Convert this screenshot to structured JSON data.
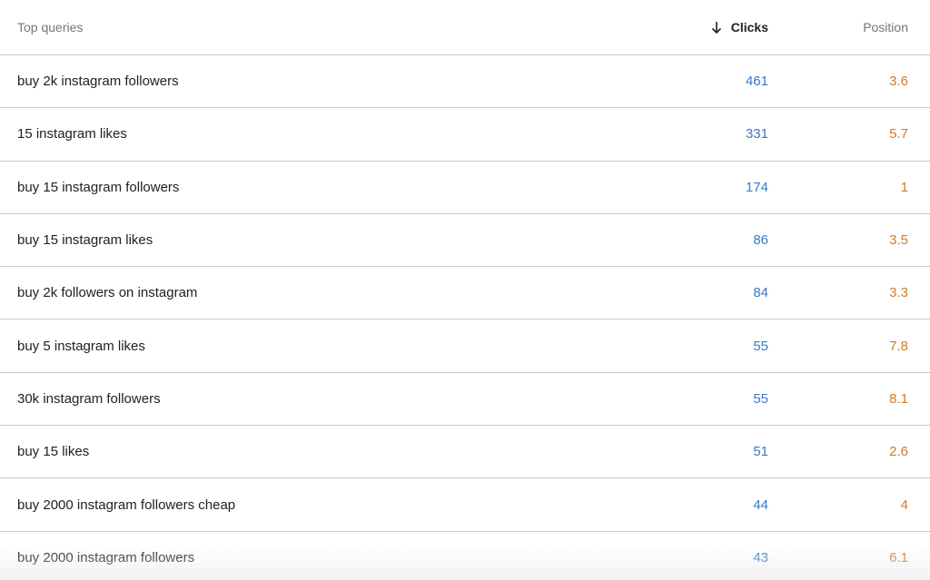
{
  "header": {
    "query_label": "Top queries",
    "clicks_label": "Clicks",
    "position_label": "Position",
    "sort_icon": "arrow-down-icon"
  },
  "colors": {
    "clicks": "#3a78c9",
    "position": "#d07b28"
  },
  "rows": [
    {
      "query": "buy 2k instagram followers",
      "clicks": "461",
      "position": "3.6"
    },
    {
      "query": "15 instagram likes",
      "clicks": "331",
      "position": "5.7"
    },
    {
      "query": "buy 15 instagram followers",
      "clicks": "174",
      "position": "1"
    },
    {
      "query": "buy 15 instagram likes",
      "clicks": "86",
      "position": "3.5"
    },
    {
      "query": "buy 2k followers on instagram",
      "clicks": "84",
      "position": "3.3"
    },
    {
      "query": "buy 5 instagram likes",
      "clicks": "55",
      "position": "7.8"
    },
    {
      "query": "30k instagram followers",
      "clicks": "55",
      "position": "8.1"
    },
    {
      "query": "buy 15 likes",
      "clicks": "51",
      "position": "2.6"
    },
    {
      "query": "buy 2000 instagram followers cheap",
      "clicks": "44",
      "position": "4"
    },
    {
      "query": "buy 2000 instagram followers",
      "clicks": "43",
      "position": "6.1"
    }
  ]
}
